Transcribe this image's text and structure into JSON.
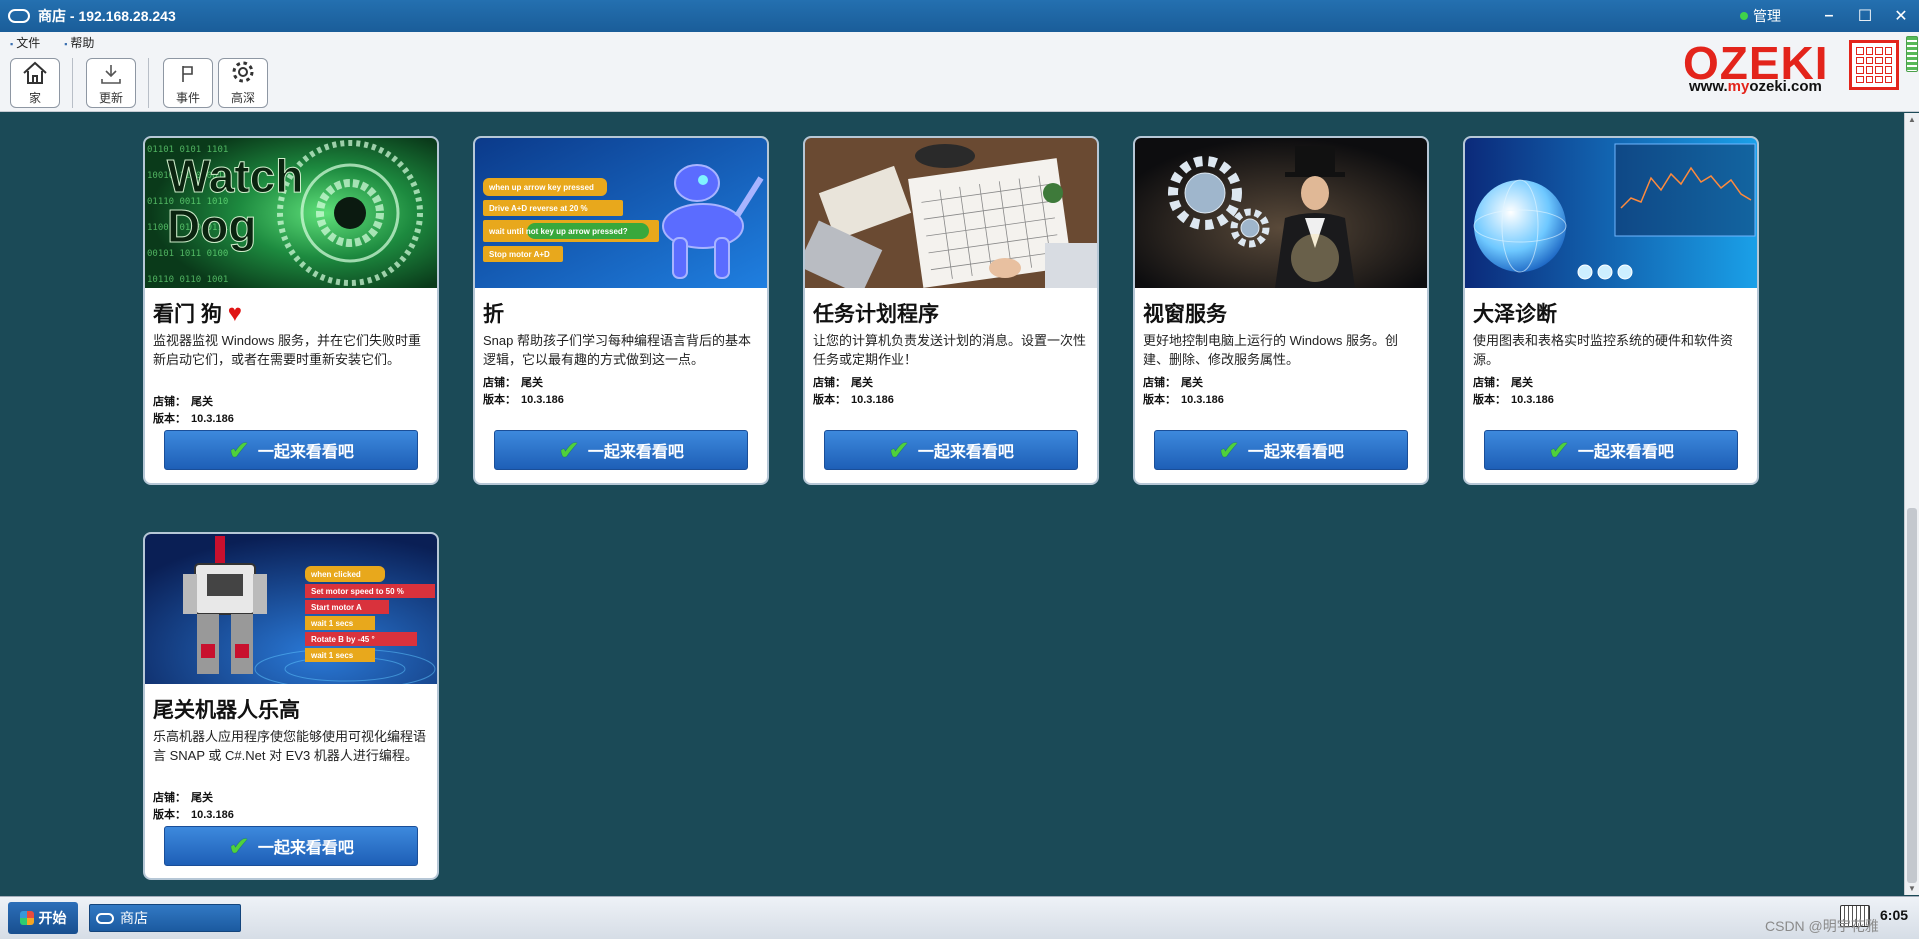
{
  "window": {
    "title": "商店 - 192.168.28.243",
    "admin_label": "管理",
    "status_color": "#3fd24a"
  },
  "menu": [
    {
      "label": "文件"
    },
    {
      "label": "帮助"
    }
  ],
  "toolbar": [
    {
      "label": "家",
      "icon": "home-icon"
    },
    {
      "label": "更新",
      "icon": "download-icon"
    },
    {
      "label": "事件",
      "icon": "flag-icon"
    },
    {
      "label": "高深",
      "icon": "gear-icon"
    }
  ],
  "logo": {
    "word": "OZEKI",
    "url_prefix": "www.",
    "url_my": "my",
    "url_suffix": "ozeki.com"
  },
  "meta_labels": {
    "store": "店铺：",
    "version": "版本："
  },
  "apps": [
    {
      "title": "看门 狗",
      "heart": "♥",
      "image_text": [
        "Watch",
        "Dog"
      ],
      "description": "监视器监视 Windows 服务，并在它们失败时重新启动它们，或者在需要时重新安装它们。",
      "store": "尾关",
      "version": "10.3.186",
      "button": "一起来看看吧"
    },
    {
      "title": "折",
      "image_text": [
        "when up arrow key pressed",
        "Drive A+D reverse at 20 %",
        "wait until not key up arrow pressed?",
        "Stop motor A+D"
      ],
      "description": "Snap 帮助孩子们学习每种编程语言背后的基本逻辑，它以最有趣的方式做到这一点。",
      "store": "尾关",
      "version": "10.3.186",
      "button": "一起来看看吧"
    },
    {
      "title": "任务计划程序",
      "description": "让您的计算机负责发送计划的消息。设置一次性任务或定期作业！",
      "store": "尾关",
      "version": "10.3.186",
      "button": "一起来看看吧"
    },
    {
      "title": "视窗服务",
      "description": "更好地控制电脑上运行的 Windows 服务。创建、删除、修改服务属性。",
      "store": "尾关",
      "version": "10.3.186",
      "button": "一起来看看吧"
    },
    {
      "title": "大泽诊断",
      "description": "使用图表和表格实时监控系统的硬件和软件资源。",
      "store": "尾关",
      "version": "10.3.186",
      "button": "一起来看看吧"
    },
    {
      "title": "尾关机器人乐高",
      "image_text": [
        "when clicked",
        "Set motor speed to 50 %",
        "Start motor A",
        "wait 1 secs",
        "Rotate B by -45 °",
        "wait 1 secs"
      ],
      "description": "乐高机器人应用程序使您能够使用可视化编程语言 SNAP 或 C#.Net 对 EV3 机器人进行编程。",
      "store": "尾关",
      "version": "10.3.186",
      "button": "一起来看看吧"
    }
  ],
  "taskbar": {
    "start_label": "开始",
    "task_label": "商店",
    "clock": "6:05"
  },
  "watermark": "CSDN @明宇花雅"
}
